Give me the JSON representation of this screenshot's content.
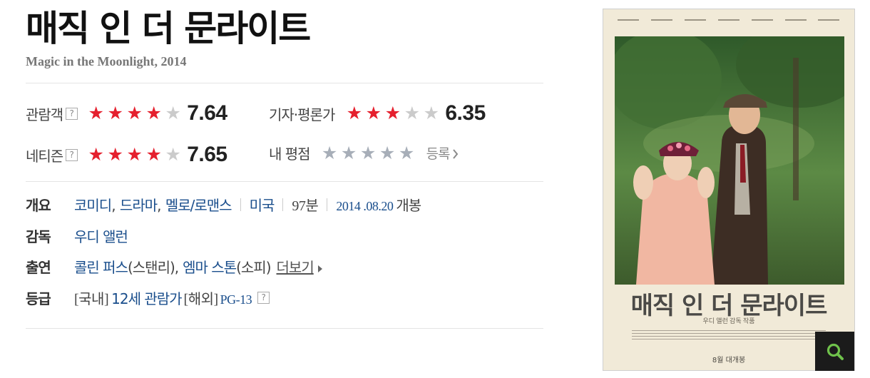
{
  "movie": {
    "title_ko": "매직 인 더 문라이트",
    "title_en": "Magic in the Moonlight, 2014"
  },
  "ratings": {
    "audience": {
      "label": "관람객",
      "help": "?",
      "score": "7.64",
      "stars_filled": 4,
      "stars_total": 5
    },
    "critics": {
      "label": "기자·평론가",
      "score": "6.35",
      "stars_filled": 3,
      "stars_total": 5
    },
    "netizen": {
      "label": "네티즌",
      "help": "?",
      "score": "7.65",
      "stars_filled": 4,
      "stars_total": 5
    },
    "mine": {
      "label": "내 평점",
      "stars_filled": 0,
      "stars_total": 5,
      "register_label": "등록"
    }
  },
  "info": {
    "overview": {
      "label": "개요",
      "genres": [
        {
          "text": "코미디",
          "suffix": ","
        },
        {
          "text": "드라마",
          "suffix": ","
        },
        {
          "text": "멜로/로맨스",
          "suffix": ""
        }
      ],
      "country": "미국",
      "runtime": "97분",
      "release_date": "2014 .08.20",
      "release_suffix": "개봉"
    },
    "director": {
      "label": "감독",
      "name": "우디 앨런"
    },
    "cast": {
      "label": "출연",
      "actors": [
        {
          "name": "콜린 퍼스",
          "role": "(스탠리)",
          "suffix": ","
        },
        {
          "name": "엠마 스톤",
          "role": "(소피)",
          "suffix": ""
        }
      ],
      "more_label": "더보기"
    },
    "grade": {
      "label": "등급",
      "domestic_prefix": "[국내]",
      "domestic_rating": "12세 관람가",
      "overseas_prefix": "[해외]",
      "overseas_rating": "PG-13",
      "help": "?"
    }
  },
  "poster": {
    "title": "매직 인 더 문라이트",
    "subtitle": "우디 앨런 감독 작품",
    "release_text": "8월 대개봉"
  },
  "colors": {
    "star_on": "#e5202e",
    "star_off": "#cbcbcb",
    "link": "#1a4e8c"
  },
  "icons": {
    "zoom": "magnifier-icon",
    "register": "chevron-right-icon",
    "more": "triangle-right-icon"
  }
}
